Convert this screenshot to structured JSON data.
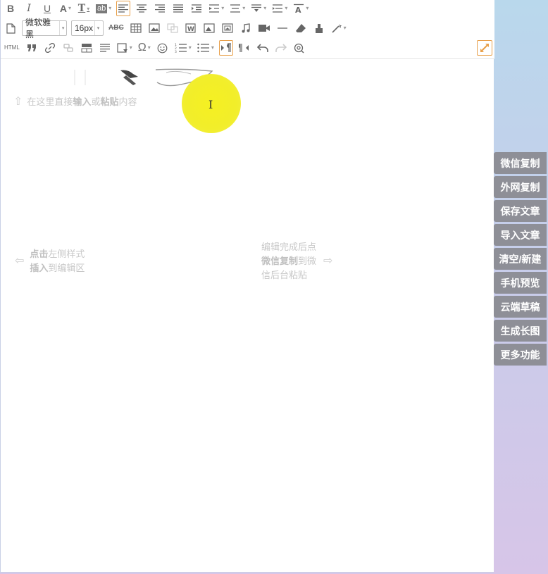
{
  "toolbar": {
    "row1": [
      {
        "name": "bold-button",
        "label": "B"
      },
      {
        "name": "italic-button",
        "label": "I"
      },
      {
        "name": "underline-button",
        "label": "U"
      },
      {
        "name": "font-color-button",
        "label": "A"
      },
      {
        "name": "font-style-button",
        "label": "T"
      },
      {
        "name": "highlight-button",
        "label": "ab"
      }
    ],
    "font_family": "微软雅黑",
    "font_size": "16px",
    "strikethrough_label": "ABC",
    "html_label": "HTML",
    "omega_label": "Ω"
  },
  "editor": {
    "hint_top": "在这里直接",
    "hint_top_bold1": "输入",
    "hint_top_mid": "或",
    "hint_top_bold2": "粘贴",
    "hint_top_end": "内容",
    "hint_left_bold1": "点击",
    "hint_left_1": "左侧样式",
    "hint_left_bold2": "插入",
    "hint_left_2": "到编辑区",
    "hint_right_line1": "编辑完成后点",
    "hint_right_bold": "微信复制",
    "hint_right_line2": "到微",
    "hint_right_line3": "信后台粘贴"
  },
  "side_buttons": [
    "微信复制",
    "外网复制",
    "保存文章",
    "导入文章",
    "清空/新建",
    "手机预览",
    "云端草稿",
    "生成长图",
    "更多功能"
  ],
  "colors": {
    "accent": "#e8a04b",
    "side_button_bg": "#8e8f97",
    "hint_text": "#c8c8c8",
    "cursor_highlight": "#f5f022"
  }
}
